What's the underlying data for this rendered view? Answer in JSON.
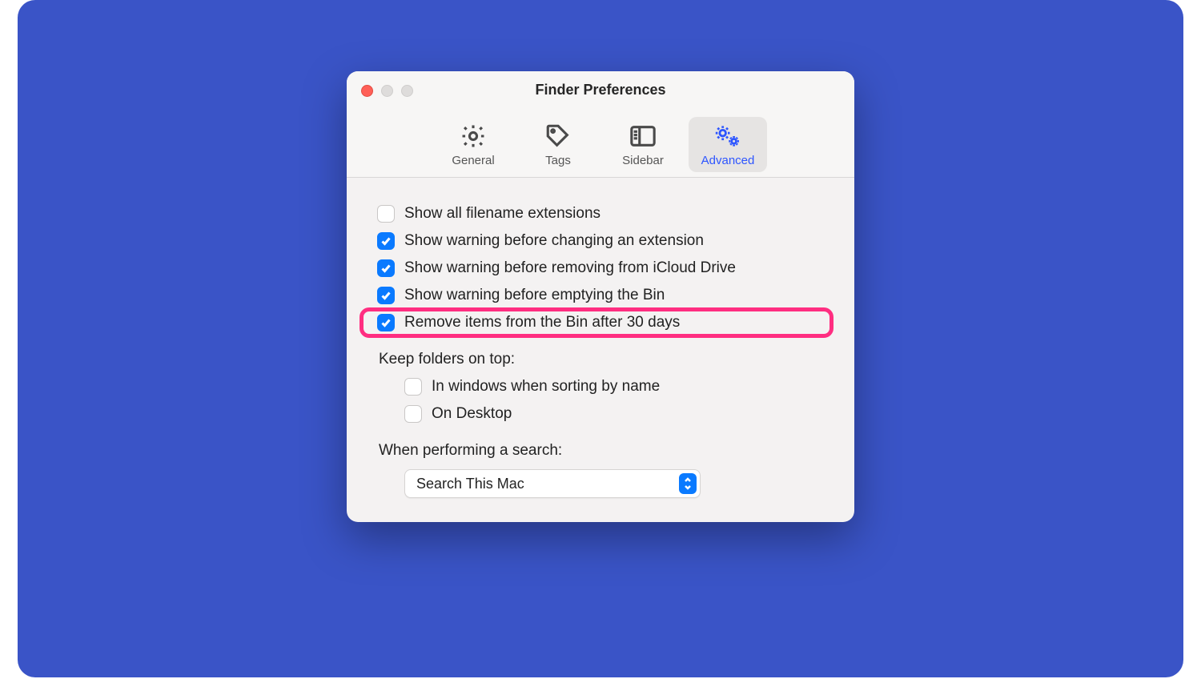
{
  "window": {
    "title": "Finder Preferences"
  },
  "tabs": {
    "items": [
      {
        "label": "General"
      },
      {
        "label": "Tags"
      },
      {
        "label": "Sidebar"
      },
      {
        "label": "Advanced"
      }
    ],
    "active_index": 3
  },
  "options": {
    "o0": {
      "label": "Show all filename extensions",
      "checked": false
    },
    "o1": {
      "label": "Show warning before changing an extension",
      "checked": true
    },
    "o2": {
      "label": "Show warning before removing from iCloud Drive",
      "checked": true
    },
    "o3": {
      "label": "Show warning before emptying the Bin",
      "checked": true
    },
    "o4": {
      "label": "Remove items from the Bin after 30 days",
      "checked": true
    }
  },
  "folders_header": "Keep folders on top:",
  "folders": {
    "f0": {
      "label": "In windows when sorting by name",
      "checked": false
    },
    "f1": {
      "label": "On Desktop",
      "checked": false
    }
  },
  "search_header": "When performing a search:",
  "search_select": {
    "value": "Search This Mac"
  },
  "highlight_key": "o4",
  "colors": {
    "accent": "#0a7aff",
    "highlight": "#ff2e81",
    "bg": "#3a54c7"
  }
}
